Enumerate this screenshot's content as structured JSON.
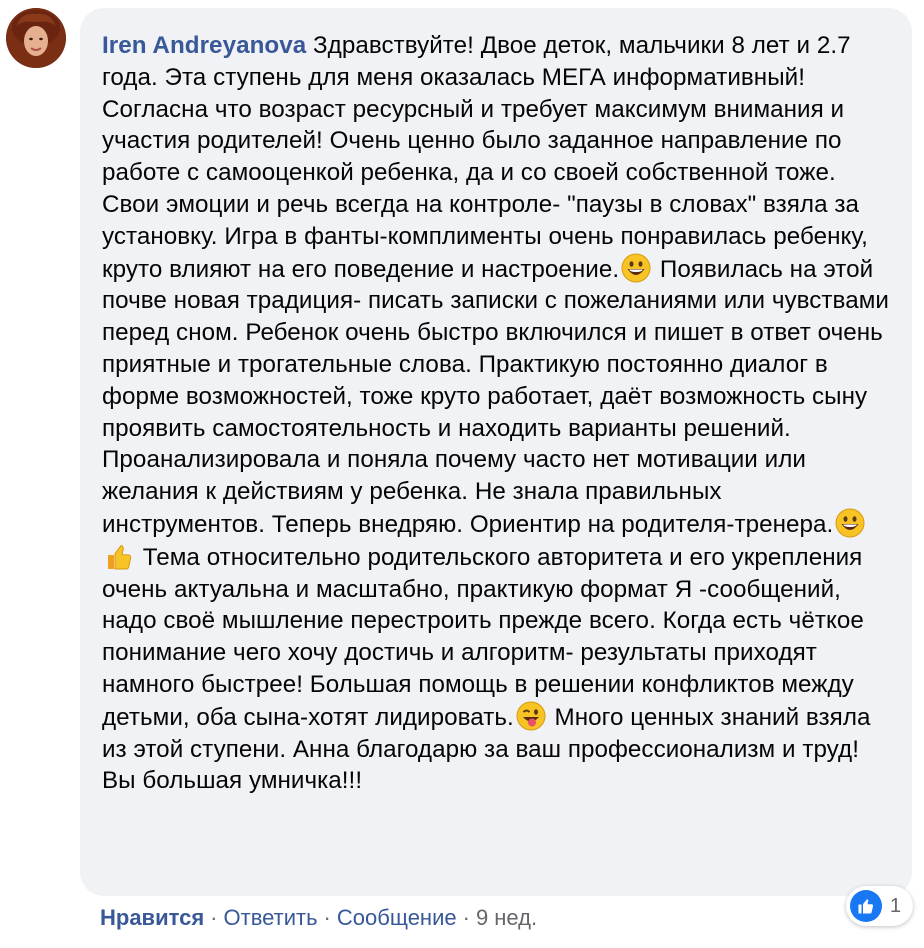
{
  "comment": {
    "author": "Iren Andreyanova",
    "segments": [
      {
        "type": "text",
        "value": " Здравствуйте! Двое деток, мальчики 8 лет и 2.7 года. Эта ступень для меня оказалась МЕГА информативный! Согласна что возраст ресурсный и требует максимум внимания и участия родителей! Очень ценно было заданное направление по работе с самооценкой ребенка, да и со своей собственной тоже. Свои эмоции и речь всегда на контроле- \"паузы в словах\" взяла за установку. Игра в фанты-комплименты очень понравилась ребенку, круто влияют на его поведение и настроение."
      },
      {
        "type": "emoji",
        "name": "grinning-face-emoji"
      },
      {
        "type": "text",
        "value": " Появилась на этой почве новая традиция- писать записки с пожеланиями или чувствами перед сном. Ребенок очень быстро включился и пишет в ответ очень приятные и трогательные слова. Практикую постоянно диалог в форме возможностей, тоже круто работает, даёт возможность сыну проявить самостоятельность и находить варианты решений. Проанализировала и поняла почему часто нет мотивации или желания к действиям у ребенка. Не знала правильных инструментов. Теперь внедряю. Ориентир на родителя-тренера."
      },
      {
        "type": "emoji",
        "name": "grinning-face-emoji"
      },
      {
        "type": "emoji",
        "name": "thumbs-up-emoji"
      },
      {
        "type": "text",
        "value": " Тема относительно родительского авторитета и его укрепления очень актуальна и масштабно, практикую формат Я -сообщений, надо своё мышление перестроить прежде всего. Когда есть чёткое понимание чего хочу достичь и алгоритм- результаты приходят намного быстрее! Большая помощь в решении конфликтов между детьми, оба сына-хотят лидировать."
      },
      {
        "type": "emoji",
        "name": "winking-tongue-face-emoji"
      },
      {
        "type": "text",
        "value": " Много ценных знаний взяла из этой ступени. Анна благодарю за ваш профессионализм и труд! Вы большая умничка!!!"
      }
    ]
  },
  "actions": {
    "like": "Нравится",
    "reply": "Ответить",
    "message": "Сообщение",
    "time": "9 нед.",
    "separator": "·"
  },
  "reactions": {
    "icon": "like-icon",
    "count": "1",
    "color": "#1877f2"
  },
  "colors": {
    "link": "#385898",
    "bubble": "#f0f2f5",
    "meta": "#65676b"
  }
}
